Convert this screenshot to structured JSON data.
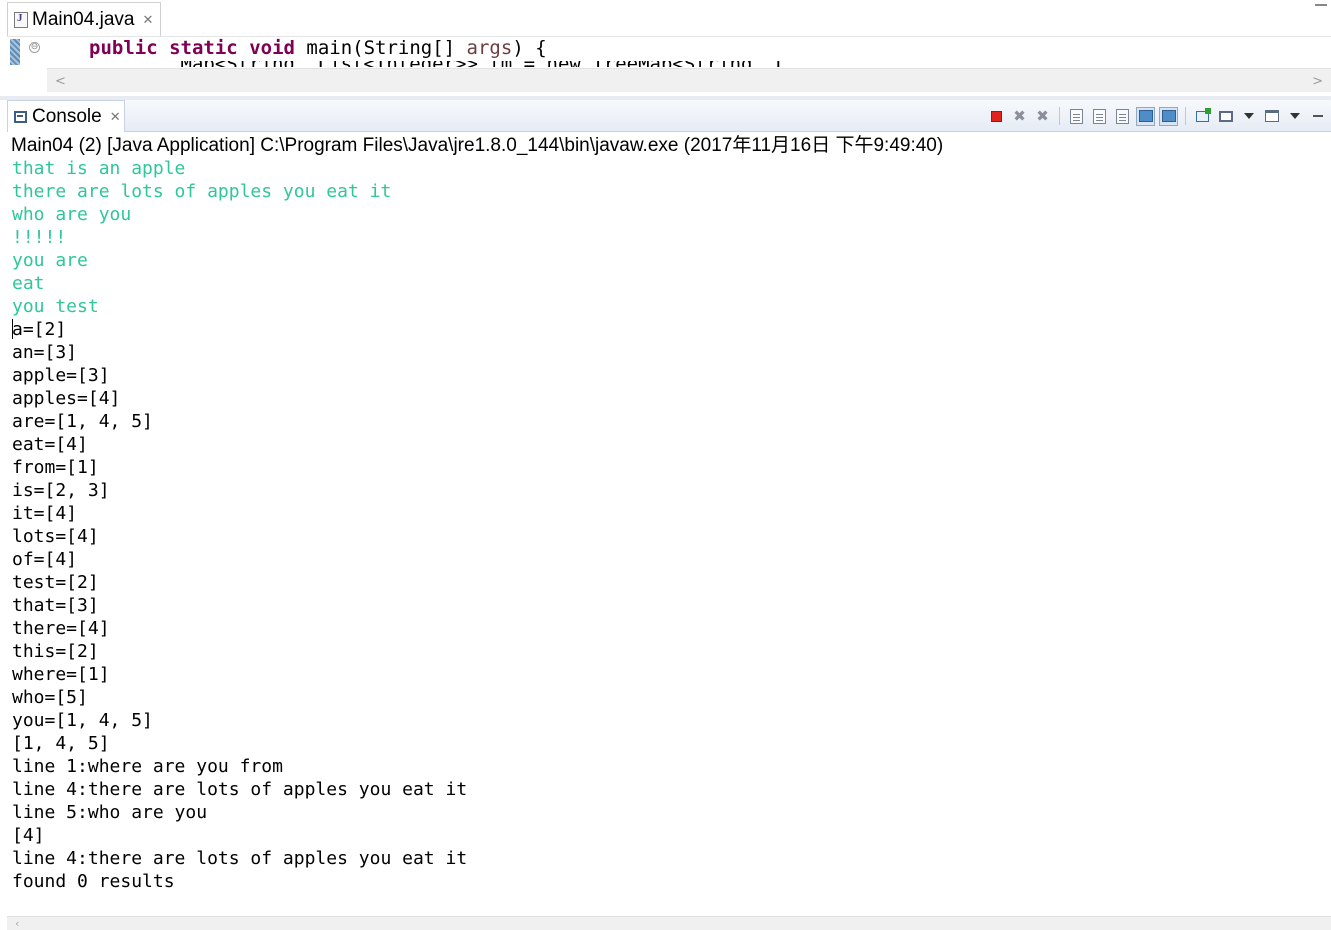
{
  "editor": {
    "tab_title": "Main04.java",
    "tab_close": "✕",
    "code_line": {
      "kw1": "public",
      "kw2": "static",
      "kw3": "void",
      "method": " main(String[] ",
      "param": "args",
      "end": ") {"
    },
    "next_line_fragment": "        Map<String, List<Integer>> tm = new TreeMap<String, List<Integer>>();",
    "scroll_left": "<",
    "scroll_right": ">"
  },
  "console": {
    "tab_title": "Console",
    "tab_close": "✕",
    "header": "Main04 (2) [Java Application] C:\\Program Files\\Java\\jre1.8.0_144\\bin\\javaw.exe (2017年11月16日 下午9:49:40)",
    "toolbar": {
      "terminate": "terminate-icon",
      "remove_launch": "remove-launch-icon",
      "remove_all": "remove-all-icon",
      "clear": "clear-console-icon",
      "scroll_lock": "scroll-lock-icon",
      "word_wrap": "word-wrap-icon",
      "show_stdout": "show-stdout-icon",
      "show_stderr": "show-stderr-icon",
      "pin": "pin-console-icon",
      "display_selected": "display-console-icon",
      "open_console": "open-console-icon",
      "minimize": "minimize-icon"
    },
    "input_color": "#2fc79a",
    "output_color": "#000000",
    "input_lines": [
      "that is an apple",
      "there are lots of apples you eat it",
      "who are you",
      "!!!!!",
      "you are",
      "eat",
      "you test"
    ],
    "output_lines": [
      "a=[2]",
      "an=[3]",
      "apple=[3]",
      "apples=[4]",
      "are=[1, 4, 5]",
      "eat=[4]",
      "from=[1]",
      "is=[2, 3]",
      "it=[4]",
      "lots=[4]",
      "of=[4]",
      "test=[2]",
      "that=[3]",
      "there=[4]",
      "this=[2]",
      "where=[1]",
      "who=[5]",
      "you=[1, 4, 5]",
      "[1, 4, 5]",
      "line 1:where are you from",
      "line 4:there are lots of apples you eat it",
      "line 5:who are you",
      "[4]",
      "line 4:there are lots of apples you eat it",
      "found 0 results"
    ]
  }
}
